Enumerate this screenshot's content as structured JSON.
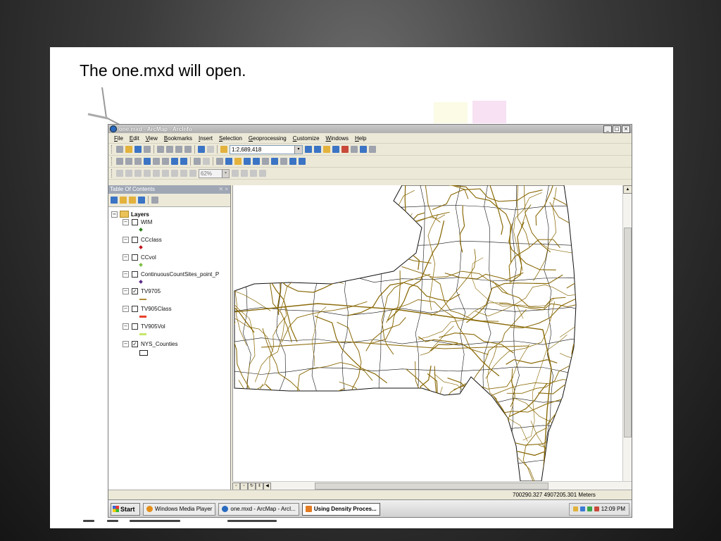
{
  "slide": {
    "title": "The one.mxd will open."
  },
  "window": {
    "title": "one.mxd - ArcMap - ArcInfo",
    "controls": [
      "_",
      "□",
      "×"
    ]
  },
  "menu": [
    "File",
    "Edit",
    "View",
    "Bookmarks",
    "Insert",
    "Selection",
    "Geoprocessing",
    "Customize",
    "Windows",
    "Help"
  ],
  "toolbar": {
    "scale_value": "1:2,689,418",
    "zoom_value": "62%",
    "dropdown_glyph": "▾"
  },
  "toc": {
    "header": "Table Of Contents",
    "pin_glyphs": "✕ ×",
    "root": "Layers",
    "layers": [
      {
        "name": "WIM",
        "checked": false,
        "symbol": "dot",
        "color": "#2e7d1e"
      },
      {
        "name": "CCclass",
        "checked": false,
        "symbol": "dot",
        "color": "#c0141c"
      },
      {
        "name": "CCvol",
        "checked": false,
        "symbol": "dot",
        "color": "#7bc143"
      },
      {
        "name": "ContinuousCountSites_point_P",
        "checked": false,
        "symbol": "dot",
        "color": "#5b2a86"
      },
      {
        "name": "TV9705",
        "checked": true,
        "symbol": "line",
        "color": "#b08d3a"
      },
      {
        "name": "TV905Class",
        "checked": false,
        "symbol": "line",
        "color": "#e8402a"
      },
      {
        "name": "TV905Vol",
        "checked": false,
        "symbol": "line",
        "color": "#c6e86a"
      },
      {
        "name": "NYS_Counties",
        "checked": true,
        "symbol": "rect",
        "color": "#222222"
      }
    ]
  },
  "map": {
    "road_color": "#8a6a08",
    "county_color": "#111111"
  },
  "status": {
    "coordinates": "700290.327  4907205.301 Meters"
  },
  "taskbar": {
    "start": "Start",
    "tasks": [
      {
        "label": "Windows Media Player",
        "active": false
      },
      {
        "label": "one.mxd - ArcMap - ArcI...",
        "active": false
      },
      {
        "label": "Using Density Proces...",
        "active": true
      }
    ],
    "clock": "12:09 PM"
  }
}
